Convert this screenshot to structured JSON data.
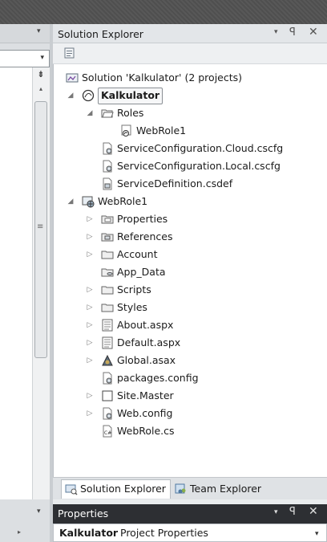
{
  "solution_explorer": {
    "title": "Solution Explorer",
    "items": [
      {
        "label": "Solution 'Kalkulator' (2 projects)",
        "icon": "solution-icon",
        "depth": 0,
        "expander": ""
      },
      {
        "label": "Kalkulator",
        "icon": "cloud-project-icon",
        "depth": 0,
        "expander": "expanded",
        "selected": true
      },
      {
        "label": "Roles",
        "icon": "folder-open-icon",
        "depth": 1,
        "expander": "expanded"
      },
      {
        "label": "WebRole1",
        "icon": "webrole-icon",
        "depth": 2,
        "expander": ""
      },
      {
        "label": "ServiceConfiguration.Cloud.cscfg",
        "icon": "config-file-icon",
        "depth": 1,
        "expander": ""
      },
      {
        "label": "ServiceConfiguration.Local.cscfg",
        "icon": "config-file-icon",
        "depth": 1,
        "expander": ""
      },
      {
        "label": "ServiceDefinition.csdef",
        "icon": "definition-file-icon",
        "depth": 1,
        "expander": ""
      },
      {
        "label": "WebRole1",
        "icon": "web-project-icon",
        "depth": 0,
        "expander": "expanded"
      },
      {
        "label": "Properties",
        "icon": "properties-folder-icon",
        "depth": 1,
        "expander": "collapsed"
      },
      {
        "label": "References",
        "icon": "references-folder-icon",
        "depth": 1,
        "expander": "collapsed"
      },
      {
        "label": "Account",
        "icon": "folder-icon",
        "depth": 1,
        "expander": "collapsed"
      },
      {
        "label": "App_Data",
        "icon": "app-data-folder-icon",
        "depth": 1,
        "expander": ""
      },
      {
        "label": "Scripts",
        "icon": "folder-icon",
        "depth": 1,
        "expander": "collapsed"
      },
      {
        "label": "Styles",
        "icon": "folder-icon",
        "depth": 1,
        "expander": "collapsed"
      },
      {
        "label": "About.aspx",
        "icon": "aspx-file-icon",
        "depth": 1,
        "expander": "collapsed"
      },
      {
        "label": "Default.aspx",
        "icon": "aspx-file-icon",
        "depth": 1,
        "expander": "collapsed"
      },
      {
        "label": "Global.asax",
        "icon": "asax-file-icon",
        "depth": 1,
        "expander": "collapsed"
      },
      {
        "label": "packages.config",
        "icon": "config-file-icon",
        "depth": 1,
        "expander": ""
      },
      {
        "label": "Site.Master",
        "icon": "master-file-icon",
        "depth": 1,
        "expander": "collapsed"
      },
      {
        "label": "Web.config",
        "icon": "config-file-icon",
        "depth": 1,
        "expander": "collapsed"
      },
      {
        "label": "WebRole.cs",
        "icon": "cs-file-icon",
        "depth": 1,
        "expander": ""
      }
    ]
  },
  "bottom_tabs": [
    {
      "label": "Solution Explorer",
      "active": true
    },
    {
      "label": "Team Explorer",
      "active": false
    }
  ],
  "properties": {
    "title": "Properties",
    "object_name": "Kalkulator",
    "object_type": "Project Properties"
  },
  "glyphs": {
    "dropdown": "▾",
    "pin": "ꟼ",
    "close": "✕",
    "split": "⇟",
    "scroll_up": "▴",
    "grip": "≡",
    "expanded": "◢",
    "collapsed": "▷",
    "left_dd": "▾",
    "left_arrow": "▸",
    "pin_char": "ꟼ"
  },
  "colors": {
    "selection_border": "#8a8f94",
    "props_titlebar": "#2d2f33",
    "panel_bg": "#ffffff"
  }
}
